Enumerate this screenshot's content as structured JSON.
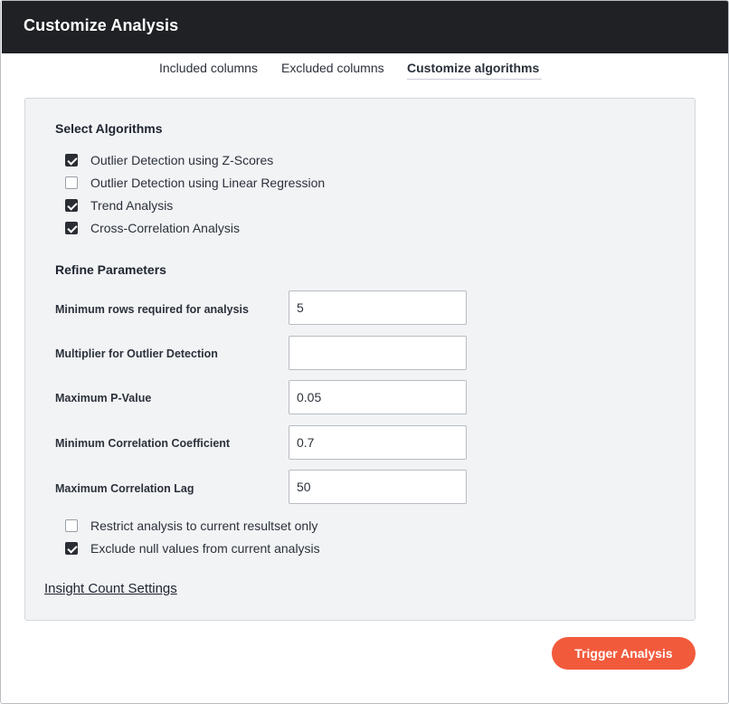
{
  "dialog": {
    "title": "Customize Analysis",
    "colors": {
      "titlebar": "#1f2125",
      "accent": "#f25a3c",
      "panel": "#f2f3f5"
    }
  },
  "tabs": [
    {
      "label": "Included columns",
      "active": false
    },
    {
      "label": "Excluded columns",
      "active": false
    },
    {
      "label": "Customize algorithms",
      "active": true
    }
  ],
  "algorithms": {
    "heading": "Select Algorithms",
    "items": [
      {
        "label": "Outlier Detection using Z-Scores",
        "checked": true
      },
      {
        "label": "Outlier Detection using Linear Regression",
        "checked": false
      },
      {
        "label": "Trend Analysis",
        "checked": true
      },
      {
        "label": "Cross-Correlation Analysis",
        "checked": true
      }
    ]
  },
  "parameters": {
    "heading": "Refine Parameters",
    "fields": [
      {
        "label": "Minimum rows required for analysis",
        "value": "5"
      },
      {
        "label": "Multiplier for Outlier Detection",
        "value": ""
      },
      {
        "label": "Maximum P-Value",
        "value": "0.05"
      },
      {
        "label": "Minimum Correlation Coefficient",
        "value": "0.7"
      },
      {
        "label": "Maximum Correlation Lag",
        "value": "50"
      }
    ]
  },
  "options": [
    {
      "label": "Restrict analysis to current resultset only",
      "checked": false
    },
    {
      "label": "Exclude null values from current analysis",
      "checked": true
    }
  ],
  "links": {
    "insight_count_settings": "Insight Count Settings"
  },
  "actions": {
    "trigger_label": "Trigger Analysis"
  }
}
